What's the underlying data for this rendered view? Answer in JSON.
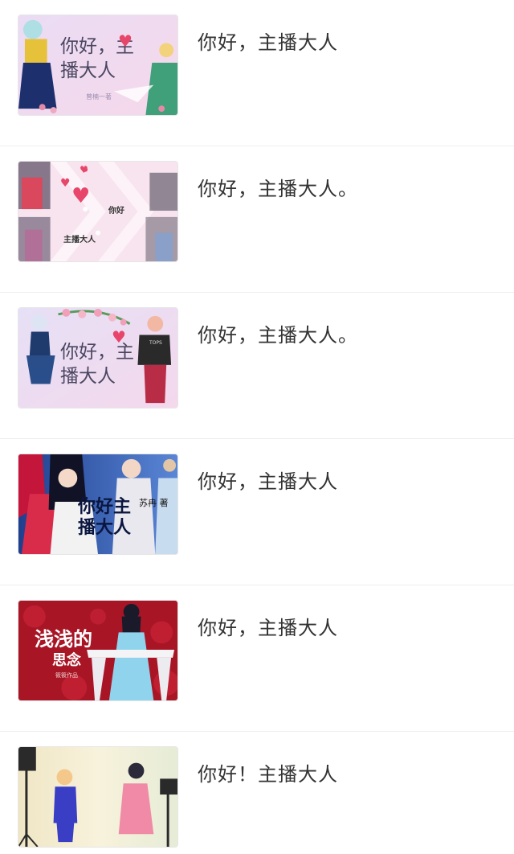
{
  "items": [
    {
      "title": "你好，主播大人",
      "cover_text": "你好，主播大人",
      "cover_author": "曾楠一著",
      "cover_icon": "heart-icon"
    },
    {
      "title": "你好，主播大人。",
      "cover_text_a": "你好",
      "cover_text_b": "主播大人",
      "cover_icon": "heart-icon"
    },
    {
      "title": "你好，主播大人。",
      "cover_text": "你好，主播大人",
      "cover_icon": "heart-icon",
      "cover_shirt": "TOPS"
    },
    {
      "title": "你好，主播大人",
      "cover_text": "你好主播大人",
      "cover_author": "苏冉 著"
    },
    {
      "title": "你好，主播大人",
      "cover_text_a": "浅浅的",
      "cover_text_b": "思念",
      "cover_author": "筱筱作品"
    },
    {
      "title": "你好！主播大人"
    }
  ],
  "colors": {
    "title": "#333333",
    "divider": "#eeeeee",
    "heart": "#e8456a"
  }
}
